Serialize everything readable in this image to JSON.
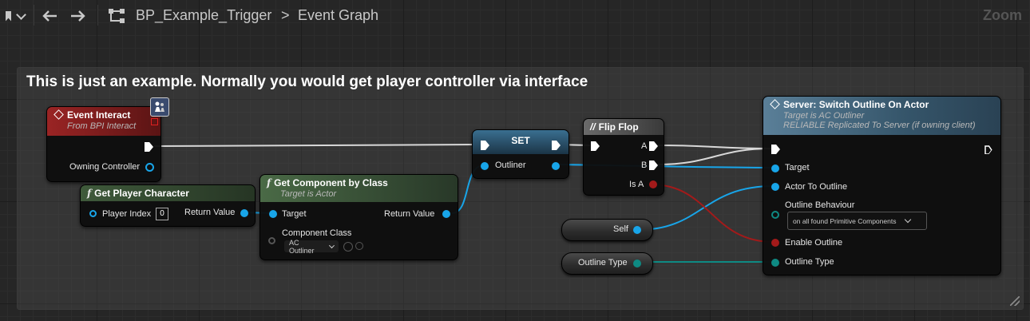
{
  "toolbar": {
    "blueprint_name": "BP_Example_Trigger",
    "separator": ">",
    "graph_name": "Event Graph",
    "zoom_label": "Zoom"
  },
  "comment": {
    "title": "This is just an example. Normally you would get player controller via interface"
  },
  "nodes": {
    "event_interact": {
      "title": "Event Interact",
      "subtitle": "From BPI Interact",
      "output_pin": "Owning Controller"
    },
    "get_player_character": {
      "title": "Get Player Character",
      "input_pin": "Player Index",
      "input_value": "0",
      "output_pin": "Return Value"
    },
    "get_component_by_class": {
      "title": "Get Component by Class",
      "subtitle": "Target is Actor",
      "target_pin": "Target",
      "class_pin": "Component Class",
      "class_value": "AC Outliner",
      "output_pin": "Return Value"
    },
    "set": {
      "title": "SET",
      "pin": "Outliner"
    },
    "flip_flop": {
      "title": "Flip Flop",
      "out_a": "A",
      "out_b": "B",
      "is_a": "Is A"
    },
    "self": {
      "label": "Self"
    },
    "outline_type": {
      "label": "Outline Type"
    },
    "server_switch": {
      "title": "Server: Switch Outline On Actor",
      "subtitle1": "Target is AC Outliner",
      "subtitle2": "RELIABLE Replicated To Server (if owning client)",
      "target_pin": "Target",
      "actor_pin": "Actor To Outline",
      "behaviour_pin": "Outline Behaviour",
      "behaviour_value": "on all found Primitive Components",
      "enable_pin": "Enable Outline",
      "type_pin": "Outline Type"
    }
  },
  "colors": {
    "event_header": "#8b1f1f",
    "function_header": "#3d5a3a",
    "pure_header": "#324a30",
    "set_header": "#2c5a77",
    "server_header": "#4c6f86",
    "object_pin": "#18a5e9",
    "bool_pin": "#a31a1a",
    "enum_pin": "#0e8a83"
  }
}
